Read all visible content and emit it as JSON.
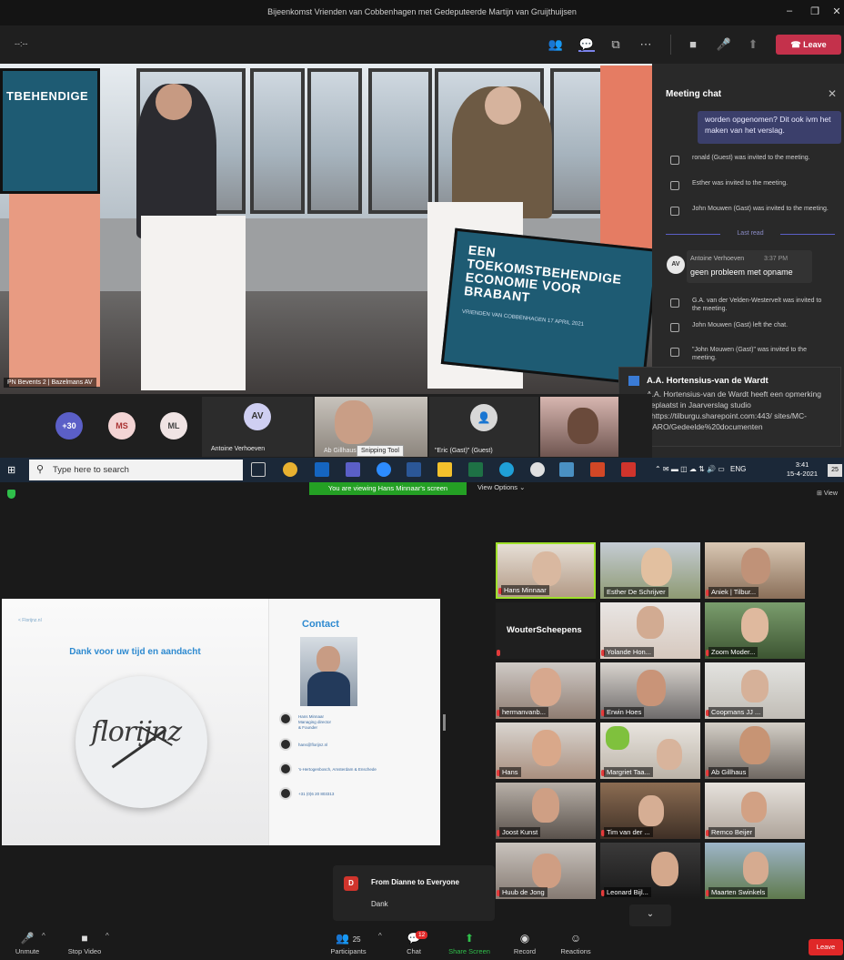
{
  "teams": {
    "window_title": "Bijeenkomst Vrienden van Cobbenhagen met Gedeputeerde Martijn van Gruijthuijsen",
    "timer": "--:--",
    "leave_label": "Leave",
    "stage_label": "PN Bevents 2 | Bazelmans AV",
    "stage_screen_left": "TBEHENDIGE",
    "stage_screen_right": "EEN TOEKOMSTBEHENDIGE ECONOMIE VOOR BRABANT",
    "stage_screen_right_sub": "VRIENDEN VAN COBBENHAGEN 17 APRIL 2021",
    "chat": {
      "title": "Meeting chat",
      "my_message": "worden opgenomen? Dit ook ivm het maken van het verslag.",
      "events_1": [
        "ronald (Guest) was invited to the meeting.",
        "Esther was invited to the meeting.",
        "John Mouwen (Gast) was invited to the meeting."
      ],
      "last_read": "Last read",
      "msg_author": "Antoine Verhoeven",
      "msg_time": "3:37 PM",
      "msg_text": "geen probleem met opname",
      "msg_initials": "AV",
      "events_2": [
        "G.A. van der Velden-Westervelt was invited to the meeting.",
        "John Mouwen (Gast) left the chat.",
        "\"John Mouwen (Gast)\" was invited to the meeting."
      ]
    },
    "toast": {
      "title": "A.A. Hortensius-van de Wardt",
      "body": "A.A. Hortensius-van de Wardt heeft een opmerking geplaatst in Jaarverslag studio <https://tilburgu.sharepoint.com:443/ sites/MC-DARO/Gedeelde%20documenten"
    },
    "gallery": {
      "more": "+30",
      "ms": "MS",
      "ml": "ML",
      "av": "AV",
      "antoine": "Antoine Verhoeven",
      "ab": "Ab Gillhaus",
      "eric": "\"Eric (Gast)\" (Guest)"
    },
    "snipping": "Snipping Tool"
  },
  "taskbar": {
    "search_placeholder": "Type here to search",
    "lang": "ENG",
    "time": "3:41",
    "date": "15-4-2021",
    "notif": "25"
  },
  "zoom": {
    "viewing_banner": "You are viewing Hans Minnaar's screen",
    "view_options": "View Options",
    "view": "View",
    "slide": {
      "back": "< Florijnz.nl",
      "thanks": "Dank voor uw tijd en aandacht",
      "logo": "florijnz",
      "contact": "Contact",
      "person": "Hans Minnaar Managing director & Founder",
      "email": "hans@florijnz.nl",
      "address": "'s-Hertogenbosch, Amsterdam & Enschede",
      "phone": "+31 (0)6 20 803313"
    },
    "tiles": [
      "Hans Minnaar",
      "Esther De Schrijver",
      "Aniek | Tilbur...",
      "WouterScheepens",
      "Yolande Hon...",
      "Zoom Moder...",
      "hermanvanb...",
      "Erwin Hoes",
      "Coopmans JJ ...",
      "Hans",
      "Margriet Taa...",
      "Ab Gillhaus",
      "Joost Kunst",
      "Tim van der ...",
      "Remco Beijer",
      "Huub de Jong",
      "Leonard Bijl...",
      "Maarten Swinkels"
    ],
    "chat_popup": {
      "initial": "D",
      "header": "From Dianne to Everyone",
      "message": "Dank"
    },
    "toolbar": {
      "unmute": "Unmute",
      "stop_video": "Stop Video",
      "participants": "Participants",
      "participants_count": "25",
      "chat": "Chat",
      "chat_badge": "12",
      "share_screen": "Share Screen",
      "record": "Record",
      "reactions": "Reactions",
      "leave": "Leave"
    }
  },
  "colors": {
    "teams_leave": "#c4314b",
    "zoom_share": "#2fbf4a",
    "zoom_leave": "#e02828",
    "teams_accent": "#5b5fc7"
  }
}
